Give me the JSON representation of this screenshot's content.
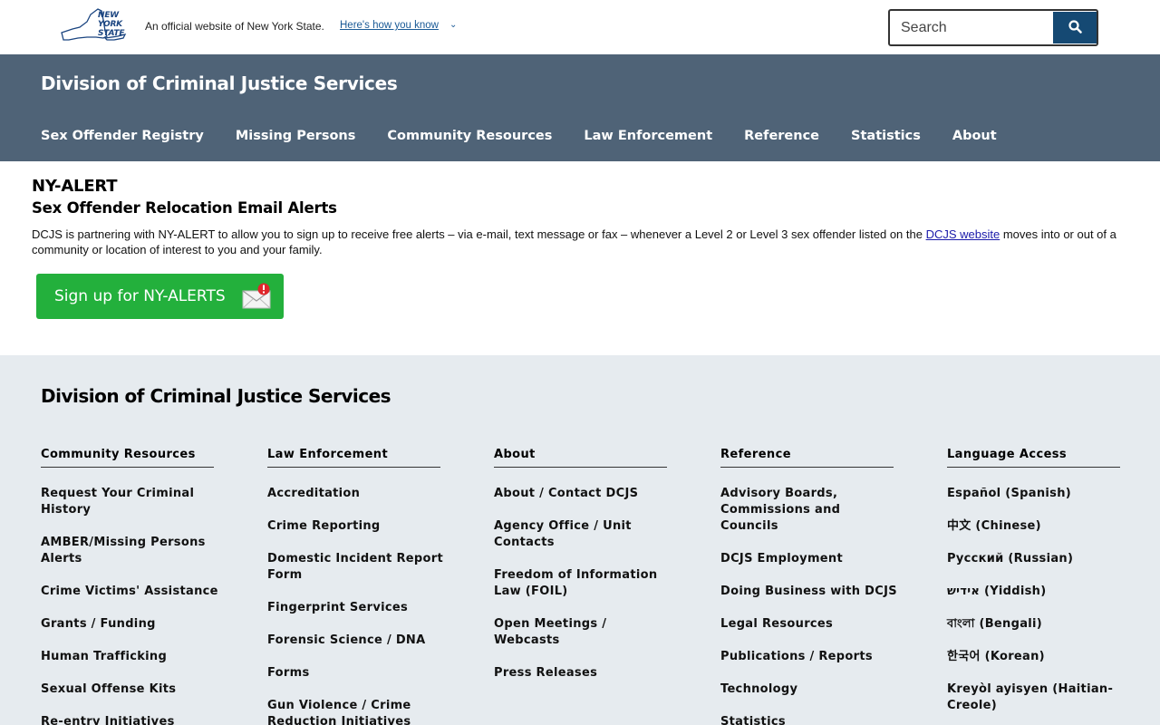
{
  "topbar": {
    "logo_lines": [
      "NEW",
      "YORK",
      "STATE"
    ],
    "official_text": "An official website of New York State.",
    "how_link": "Here's how you know",
    "search_placeholder": "Search"
  },
  "header": {
    "agency_title": "Division of Criminal Justice Services",
    "nav": [
      "Sex Offender Registry",
      "Missing Persons",
      "Community Resources",
      "Law Enforcement",
      "Reference",
      "Statistics",
      "About"
    ]
  },
  "main": {
    "title": "NY-ALERT",
    "subtitle": "Sex Offender Relocation Email Alerts",
    "body_before": "DCJS is partnering with NY-ALERT to allow you to sign up to receive free alerts – via e-mail, text message or fax – whenever a Level 2 or Level 3 sex offender listed on the ",
    "body_link": "DCJS website",
    "body_after": " moves into or out of a community or location of interest to you and your family.",
    "signup_label": "Sign up for NY-ALERTS"
  },
  "footer": {
    "title": "Division of Criminal Justice Services",
    "columns": [
      {
        "heading": "Community Resources",
        "items": [
          "Request Your Criminal History",
          "AMBER/Missing Persons Alerts",
          "Crime Victims' Assistance",
          "Grants / Funding",
          "Human Trafficking",
          "Sexual Offense Kits",
          "Re-entry Initiatives"
        ]
      },
      {
        "heading": "Law Enforcement",
        "items": [
          "Accreditation",
          "Crime Reporting",
          "Domestic Incident Report Form",
          "Fingerprint Services",
          "Forensic Science / DNA",
          "Forms",
          "Gun Violence / Crime Reduction Initiatives"
        ]
      },
      {
        "heading": "About",
        "items": [
          "About / Contact DCJS",
          "Agency Office / Unit Contacts",
          "Freedom of Information Law (FOIL)",
          "Open Meetings / Webcasts",
          "Press Releases"
        ]
      },
      {
        "heading": "Reference",
        "items": [
          "Advisory Boards, Commissions and Councils",
          "DCJS Employment",
          "Doing Business with DCJS",
          "Legal Resources",
          "Publications / Reports",
          "Technology",
          "Statistics"
        ]
      },
      {
        "heading": "Language Access",
        "items": [
          "Español (Spanish)",
          "中文 (Chinese)",
          "Русский (Russian)",
          "אידיש (Yiddish)",
          "বাংলা (Bengali)",
          "한국어 (Korean)",
          "Kreyòl ayisyen (Haitian-Creole)"
        ]
      }
    ]
  },
  "colors": {
    "header_bg": "#4f6377",
    "search_button": "#154973",
    "signup_button": "#23b03c",
    "footer_bg": "#e6ebef",
    "link": "#1a5a96"
  }
}
